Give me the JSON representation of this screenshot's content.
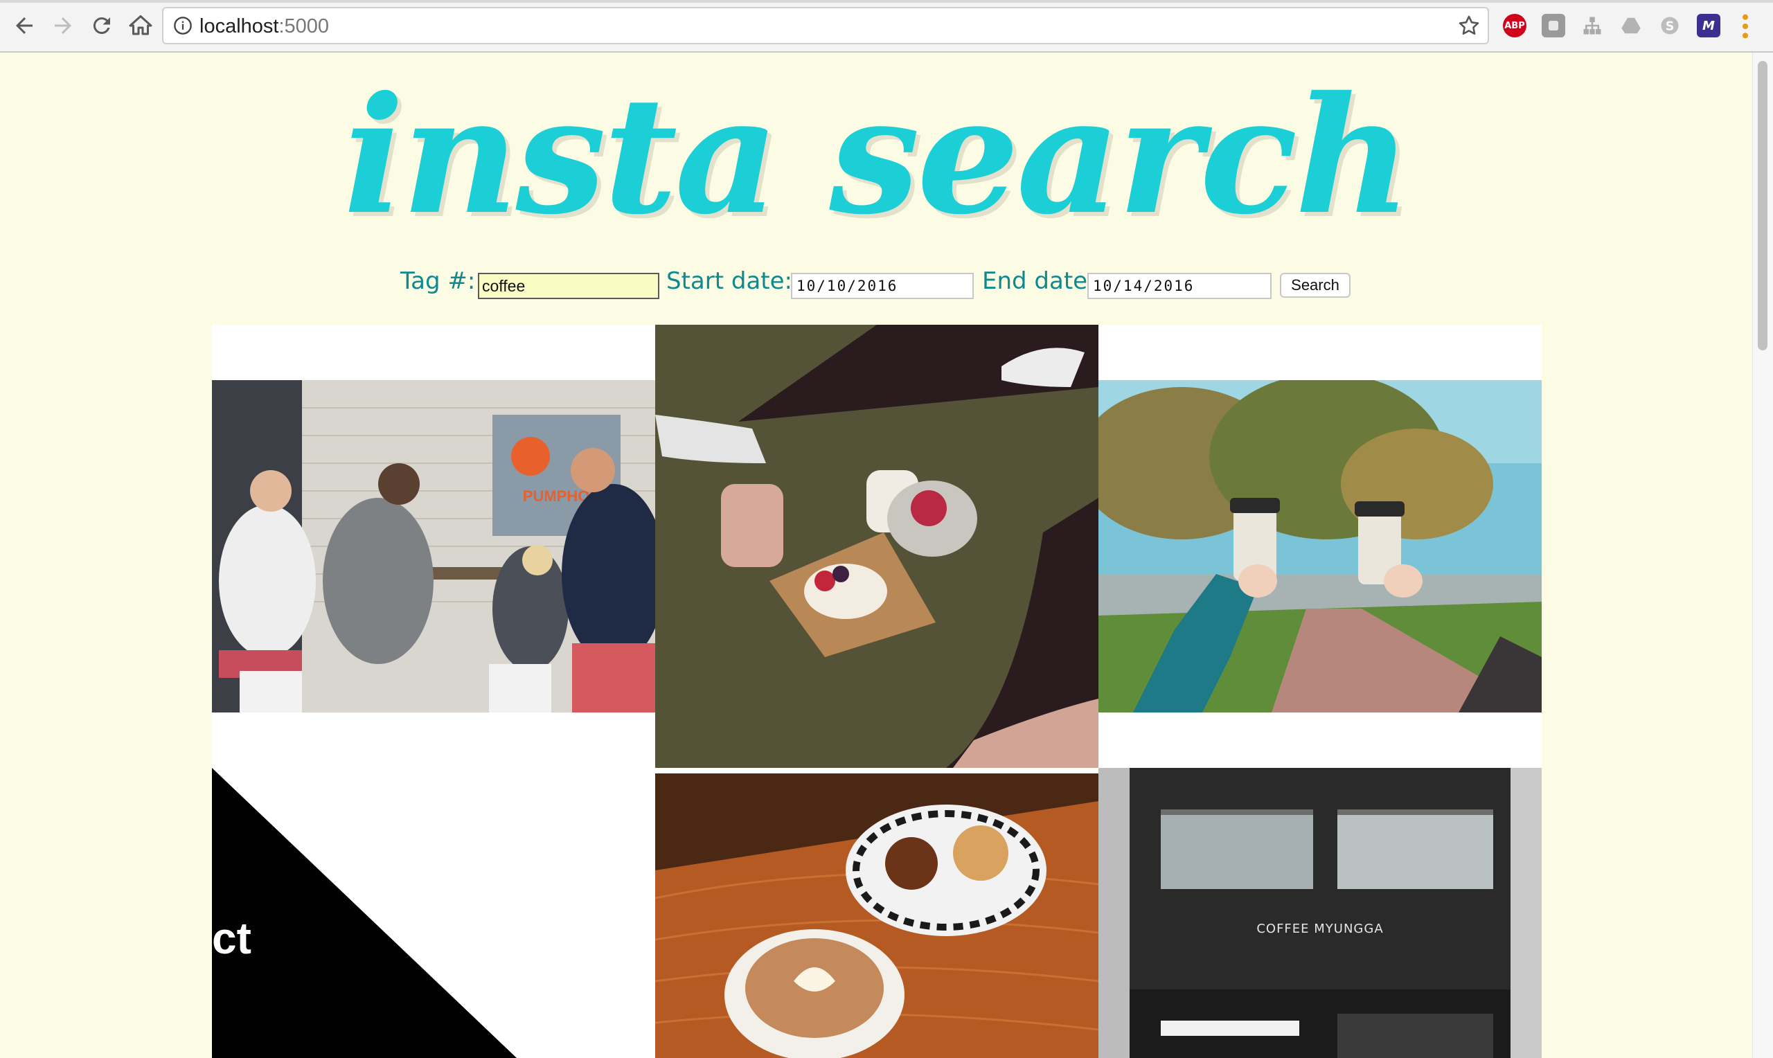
{
  "browser": {
    "url_host": "localhost",
    "url_port": ":5000",
    "icons": [
      "back-icon",
      "forward-icon",
      "reload-icon",
      "home-icon",
      "info-icon",
      "bookmark-star-icon",
      "adblock-icon",
      "extension-icon",
      "sitemap-icon",
      "drive-icon",
      "skype-icon",
      "extension-m-icon",
      "menu-icon"
    ],
    "abp_label": "ABP",
    "m_label": "M"
  },
  "page": {
    "logo": "insta search",
    "form": {
      "tag_label": "Tag #:",
      "tag_value": "coffee",
      "start_label": "Start date:",
      "start_value": "10/10/2016",
      "end_label": "End date:",
      "end_value": "10/14/2016",
      "search_label": "Search"
    },
    "photos": [
      {
        "alt": "people-sitting-at-cafe-wall",
        "sign_text": "PUMPHOU"
      },
      {
        "alt": "picnic-with-food-on-grass"
      },
      {
        "alt": "two-coffee-cups-in-park"
      },
      {
        "alt": "black-and-white-graphic",
        "text": "ct"
      },
      {
        "alt": "coffee-and-muffins-on-table"
      },
      {
        "alt": "coffee-shop-building",
        "sign_text": "COFFEE MYUNGGA"
      }
    ]
  },
  "colors": {
    "background": "#fcfbe3",
    "logo": "#1ccfd6",
    "label": "#0e8a8e",
    "tag_input_bg": "#fbfbc4"
  }
}
